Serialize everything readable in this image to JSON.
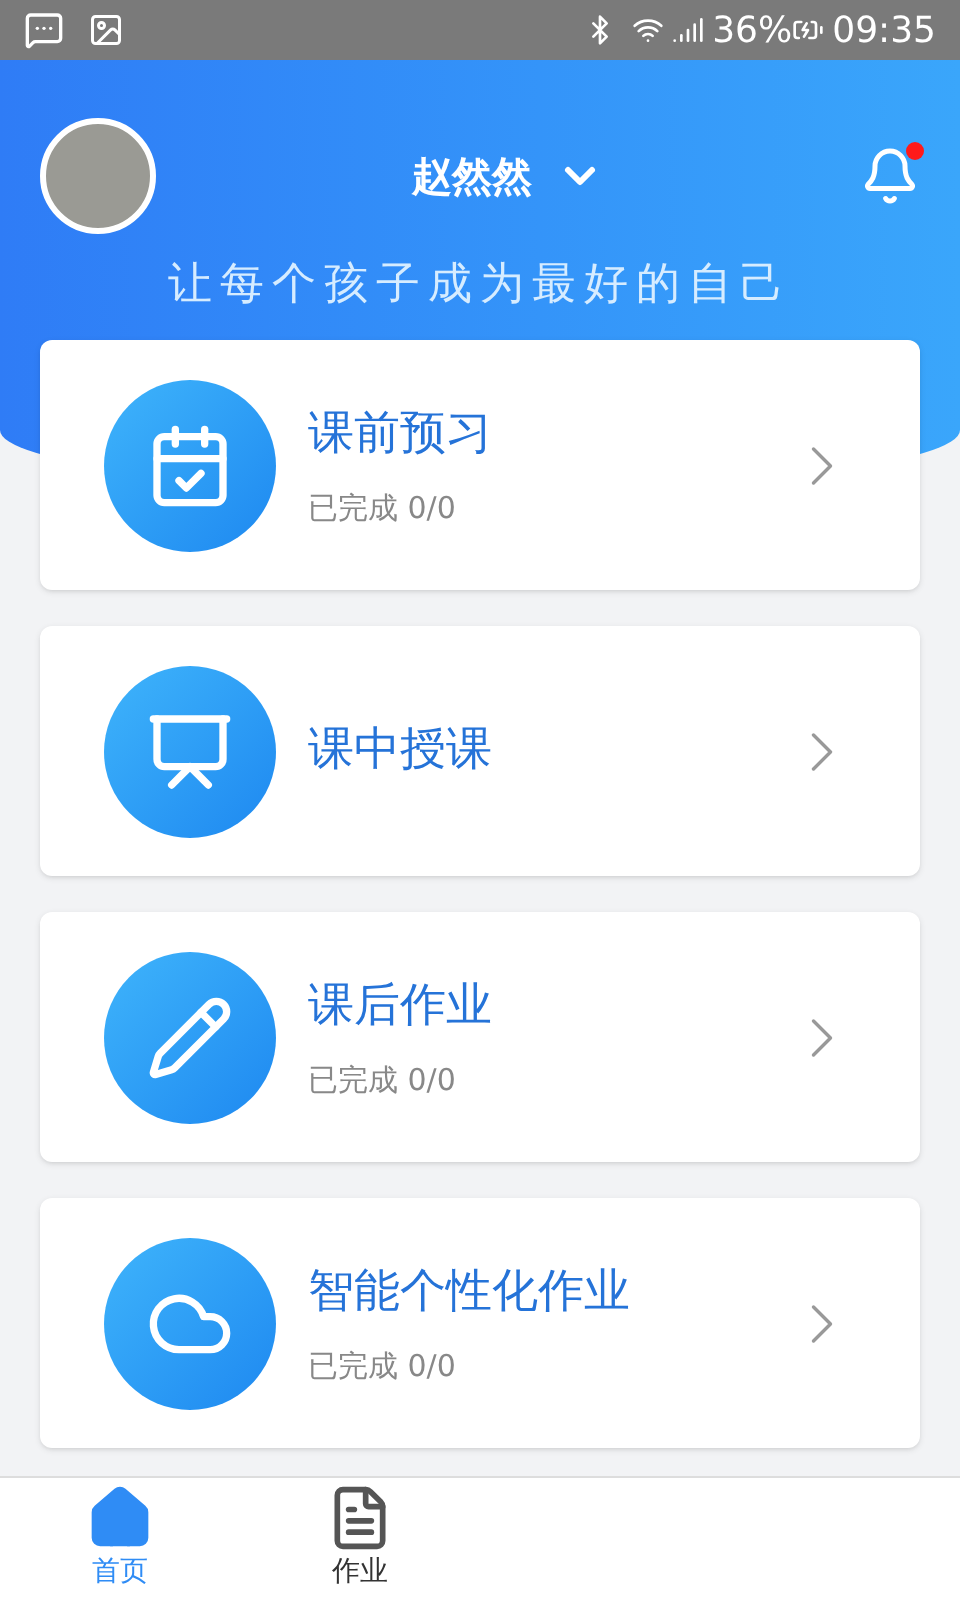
{
  "status_bar": {
    "battery": "36%",
    "time": "09:35"
  },
  "header": {
    "user_name": "赵然然",
    "has_notification": true,
    "slogan": "让每个孩子成为最好的自己"
  },
  "modules": [
    {
      "kind": "preview",
      "title": "课前预习",
      "progress": "已完成 0/0"
    },
    {
      "kind": "lesson",
      "title": "课中授课"
    },
    {
      "kind": "homework",
      "title": "课后作业",
      "progress": "已完成 0/0"
    },
    {
      "kind": "smart",
      "title": "智能个性化作业",
      "progress": "已完成 0/0"
    }
  ],
  "tabs": [
    {
      "kind": "home",
      "label": "首页",
      "selected": true
    },
    {
      "kind": "homework",
      "label": "作业",
      "selected": false
    }
  ]
}
